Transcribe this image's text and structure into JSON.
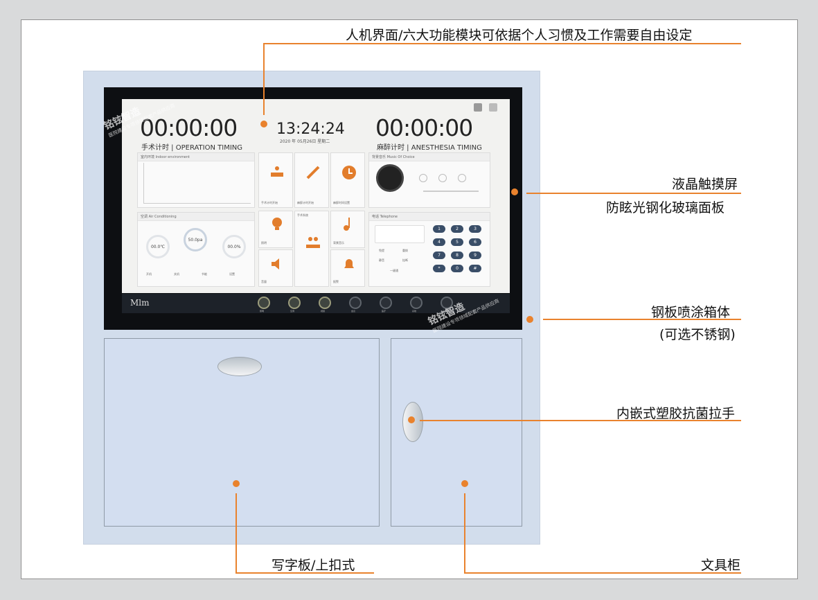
{
  "screen": {
    "operation_timer": "00:00:00",
    "operation_label": "手术计时 | OPERATION  TIMING",
    "anesthesia_timer": "00:00:00",
    "anesthesia_label": "麻醉计时 | ANESTHESIA TIMING",
    "clock": "13:24:24",
    "date": "2020 年 05月26日     星期二",
    "indoor_title": "室内环境  Indoor environment",
    "ac_title": "空调  Air Conditioning",
    "ac_values": [
      "00.0℃",
      "50.0pa",
      "00.0%"
    ],
    "ac_buttons": [
      "开机",
      "关机",
      "节能",
      "设置"
    ],
    "music_title": "背景音乐  Music Of Choice",
    "phone_title": "电话  Telephone",
    "phone_keys": [
      "1",
      "2",
      "3",
      "4",
      "5",
      "6",
      "7",
      "8",
      "9",
      "*",
      "0",
      "#"
    ],
    "phone_actions": [
      "免提",
      "重拨",
      "静音",
      "挂断",
      "一键通"
    ],
    "tiles": [
      "手术计时开始",
      "麻醉计时开始",
      "麻醉时间设置",
      "照明",
      "手术系统",
      "背景音乐",
      "音量",
      "报警"
    ],
    "dock_labels": [
      "照明",
      "空调",
      "视频",
      "会议",
      "医疗",
      "系统",
      "设置"
    ],
    "logo": "Mlm",
    "watermark_title": "铭铉智造",
    "watermark_sub": "医院建设专项领域配套产品供应商"
  },
  "callouts": {
    "hmi": "人机界面/六大功能模块可依据个人习惯及工作需要自由设定",
    "lcd": "液晶触摸屏",
    "glass": "防眩光钢化玻璃面板",
    "steel": "钢板喷涂箱体",
    "stainless": "(可选不锈钢)",
    "handle": "内嵌式塑胶抗菌拉手",
    "writing_board": "写字板/上扣式",
    "stationery": "文具柜"
  },
  "colors": {
    "accent": "#e9822d",
    "cabinet": "#d2ddec",
    "screen_dark": "#0d0f12",
    "icon_orange": "#e27d2c",
    "key_blue": "#3a4e68"
  }
}
